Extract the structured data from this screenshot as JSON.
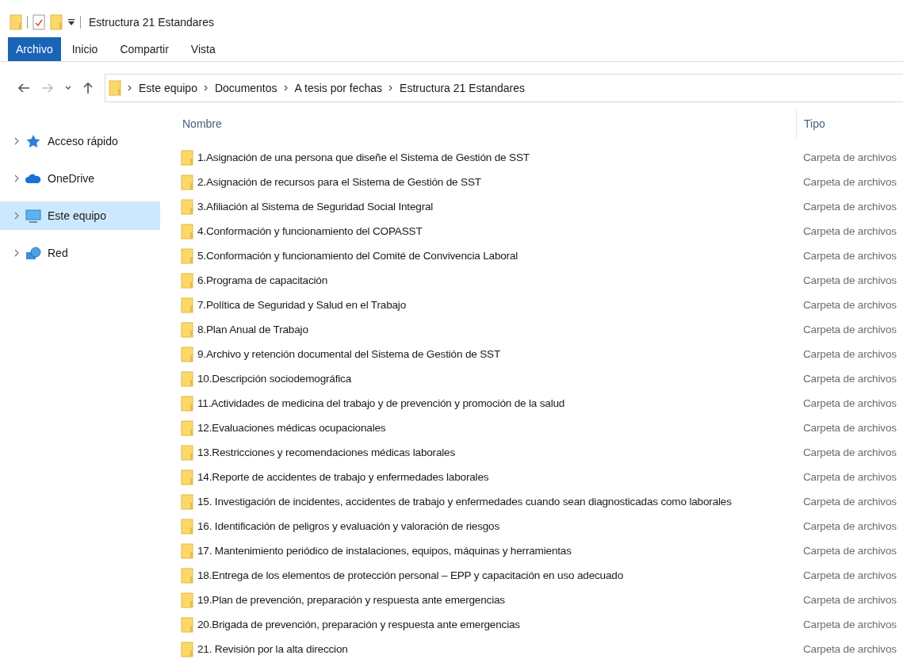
{
  "window": {
    "title": "Estructura 21 Estandares"
  },
  "ribbon_tabs": [
    {
      "label": "Archivo",
      "selected": true
    },
    {
      "label": "Inicio",
      "selected": false
    },
    {
      "label": "Compartir",
      "selected": false
    },
    {
      "label": "Vista",
      "selected": false
    }
  ],
  "nav_buttons": [
    {
      "kind": "back",
      "disabled": false
    },
    {
      "kind": "forward",
      "disabled": true
    },
    {
      "kind": "recent",
      "disabled": false
    },
    {
      "kind": "up",
      "disabled": false
    }
  ],
  "breadcrumbs": [
    "Este equipo",
    "Documentos",
    "A tesis por fechas",
    "Estructura 21 Estandares"
  ],
  "sidebar": {
    "items": [
      {
        "kind": "quick",
        "label": "Acceso rápido",
        "selected": false
      },
      {
        "kind": "cloud",
        "label": "OneDrive",
        "selected": false
      },
      {
        "kind": "pc",
        "label": "Este equipo",
        "selected": true
      },
      {
        "kind": "network",
        "label": "Red",
        "selected": false
      }
    ]
  },
  "table": {
    "columns": [
      "Nombre",
      "Tipo"
    ],
    "rows": [
      {
        "name": "1.Asignación de una persona que diseñe el Sistema de Gestión de SST",
        "type": "Carpeta de archivos"
      },
      {
        "name": "2.Asignación de recursos para el Sistema de Gestión de SST",
        "type": "Carpeta de archivos"
      },
      {
        "name": "3.Afiliación al Sistema de Seguridad Social Integral",
        "type": "Carpeta de archivos"
      },
      {
        "name": "4.Conformación y funcionamiento del COPASST",
        "type": "Carpeta de archivos"
      },
      {
        "name": "5.Conformación y funcionamiento del Comité de Convivencia Laboral",
        "type": "Carpeta de archivos"
      },
      {
        "name": "6.Programa de capacitación",
        "type": "Carpeta de archivos"
      },
      {
        "name": "7.Política de Seguridad y Salud en el Trabajo",
        "type": "Carpeta de archivos"
      },
      {
        "name": "8.Plan Anual de Trabajo",
        "type": "Carpeta de archivos"
      },
      {
        "name": "9.Archivo y retención documental del Sistema de Gestión de SST",
        "type": "Carpeta de archivos"
      },
      {
        "name": "10.Descripción sociodemográfica",
        "type": "Carpeta de archivos"
      },
      {
        "name": "11.Actividades de medicina del trabajo y de prevención y promoción de la salud",
        "type": "Carpeta de archivos"
      },
      {
        "name": "12.Evaluaciones médicas ocupacionales",
        "type": "Carpeta de archivos"
      },
      {
        "name": "13.Restricciones y recomendaciones médicas laborales",
        "type": "Carpeta de archivos"
      },
      {
        "name": "14.Reporte de accidentes de trabajo y enfermedades laborales",
        "type": "Carpeta de archivos"
      },
      {
        "name": "15. Investigación de incidentes, accidentes de trabajo y enfermedades cuando sean diagnosticadas como laborales",
        "type": "Carpeta de archivos"
      },
      {
        "name": "16. Identificación de peligros y evaluación y valoración de riesgos",
        "type": "Carpeta de archivos"
      },
      {
        "name": "17. Mantenimiento periódico de instalaciones, equipos, máquinas y herramientas",
        "type": "Carpeta de archivos"
      },
      {
        "name": "18.Entrega de los elementos de protección personal – EPP y capacitación en uso adecuado",
        "type": "Carpeta de archivos"
      },
      {
        "name": "19.Plan de prevención, preparación y respuesta ante emergencias",
        "type": "Carpeta de archivos"
      },
      {
        "name": "20.Brigada de prevención, preparación y respuesta ante emergencias",
        "type": "Carpeta de archivos"
      },
      {
        "name": "21. Revisión por la alta direccion",
        "type": "Carpeta de archivos"
      }
    ]
  }
}
